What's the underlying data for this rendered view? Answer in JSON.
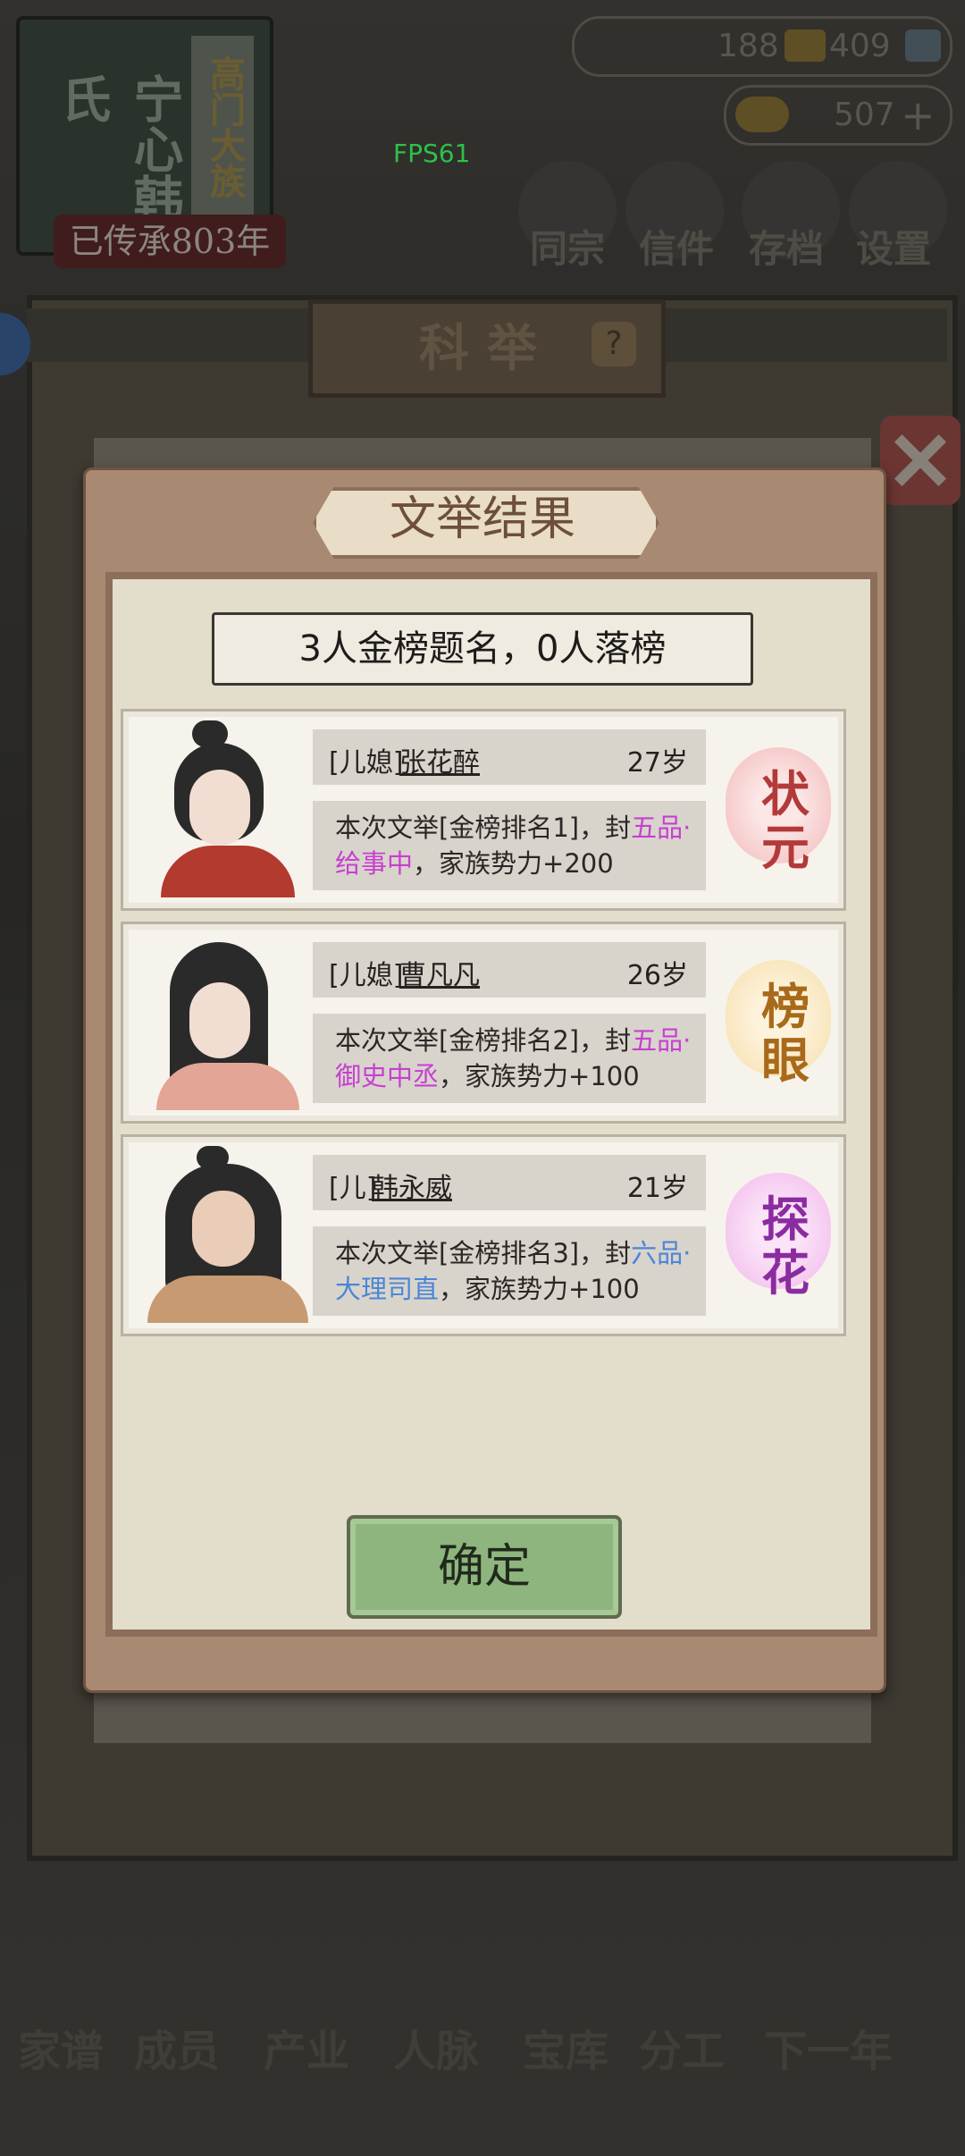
{
  "background": {
    "clan_name": "宁心韩氏",
    "clan_subtitle": "高门大族",
    "inherit_text": "已传承803年",
    "fps": "FPS61",
    "res1": "188",
    "res2": "409",
    "res3": "507",
    "top_buttons": [
      "同宗",
      "信件",
      "存档",
      "设置"
    ],
    "board_title": "科举",
    "bottom_nav": [
      "家谱",
      "成员",
      "产业",
      "人脉",
      "宝库",
      "分工",
      "下一年"
    ]
  },
  "modal": {
    "title": "文举结果",
    "summary": "3人金榜题名，0人落榜",
    "results": [
      {
        "relation": "[儿媳]",
        "name": "张花醉",
        "age": "27岁",
        "desc_pre": "本次文举[金榜排名1]，封",
        "post_1": "五",
        "post_2": "品·给事中",
        "desc_post": "，家族势力+200",
        "rank": "状元",
        "rank_c1": "状",
        "rank_c2": "元",
        "post_color": "#c83fd0",
        "seal_color": "#f2b8b8",
        "rank_color": "#b33a3a"
      },
      {
        "relation": "[儿媳]",
        "name": "曹凡凡",
        "age": "26岁",
        "desc_pre": "本次文举[金榜排名2]，封",
        "post_1": "五",
        "post_2": "品·御史中丞",
        "desc_post": "，家族势力+100",
        "rank": "榜眼",
        "rank_c1": "榜",
        "rank_c2": "眼",
        "post_color": "#c83fd0",
        "seal_color": "#f5deaa",
        "rank_color": "#a86a1a"
      },
      {
        "relation": "[儿]",
        "name": "韩永威",
        "age": "21岁",
        "desc_pre": "本次文举[金榜排名3]，封",
        "post_1": "六",
        "post_2": "品·大理司直",
        "desc_post": "，家族势力+100",
        "rank": "探花",
        "rank_c1": "探",
        "rank_c2": "花",
        "post_color": "#4a86d6",
        "seal_color": "#f0b8ea",
        "rank_color": "#8a2ca0"
      }
    ],
    "confirm_label": "确定"
  }
}
